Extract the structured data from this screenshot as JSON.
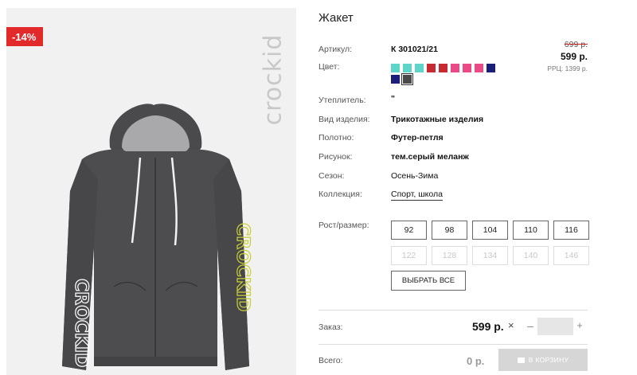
{
  "product": {
    "discount_badge": "-14%",
    "brand": "crockid",
    "title": "Жакет"
  },
  "details": {
    "article_label": "Артикул:",
    "article_value": "К 301021/21",
    "color_label": "Цвет:",
    "insulation_label": "Утеплитель:",
    "insulation_value": "\"",
    "type_label": "Вид изделия:",
    "type_value": "Трикотажные изделия",
    "fabric_label": "Полотно:",
    "fabric_value": "Футер-петля",
    "pattern_label": "Рисунок:",
    "pattern_value": "тем.серый меланж",
    "season_label": "Сезон:",
    "season_value": "Осень-Зима",
    "collection_label": "Коллекция:",
    "collection_value": "Спорт, школа"
  },
  "price": {
    "old": "699 р.",
    "current": "599 р.",
    "rrc": "РРЦ: 1399 р."
  },
  "colors": [
    {
      "hex": "#5fd4c8"
    },
    {
      "hex": "#5fd4c8"
    },
    {
      "hex": "#5fd4c8"
    },
    {
      "hex": "#c62a32"
    },
    {
      "hex": "#c62a32"
    },
    {
      "hex": "#ea4b86"
    },
    {
      "hex": "#ea4b86"
    },
    {
      "hex": "#ea4b86"
    },
    {
      "hex": "#1c1f7a"
    },
    {
      "hex": "#1c1f7a"
    },
    {
      "hex": "#4a4a4a",
      "selected": true
    }
  ],
  "sizes": {
    "label": "Рост/размер:",
    "available": [
      "92",
      "98",
      "104",
      "110",
      "116"
    ],
    "unavailable": [
      "122",
      "128",
      "134",
      "140",
      "146"
    ],
    "select_all": "ВЫБРАТЬ ВСЕ"
  },
  "order": {
    "label": "Заказ:",
    "amount": "599 р.",
    "times": "×",
    "minus": "–",
    "plus": "+",
    "quantity": ""
  },
  "total": {
    "label": "Всего:",
    "amount": "0 р.",
    "cart_button": "В КОРЗИНУ"
  }
}
